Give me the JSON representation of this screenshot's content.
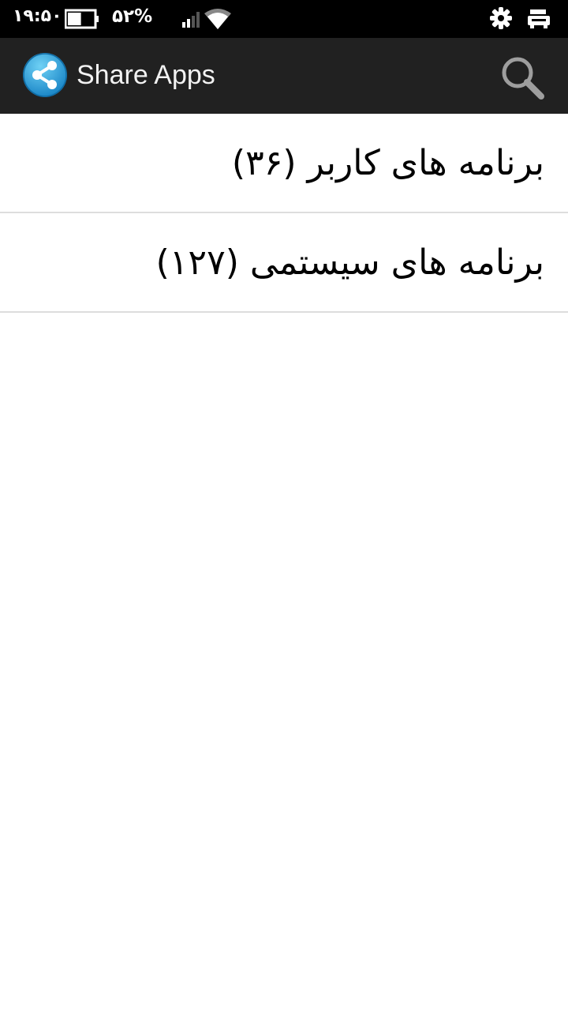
{
  "status_bar": {
    "time": "۱۹:۵۰",
    "battery_percent": "۵۲%",
    "battery_level": 0.52,
    "icons": [
      "battery-icon",
      "signal-icon",
      "wifi-icon",
      "gear-icon",
      "notification-icon"
    ]
  },
  "action_bar": {
    "app_icon": "share-icon",
    "title": "Share Apps",
    "search_icon": "search-icon",
    "background_color": "#212121",
    "accent_color": "#33aadd"
  },
  "list": {
    "items": [
      {
        "label": "برنامه های کاربر (۳۶)"
      },
      {
        "label": "برنامه های سیستمی (۱۲۷)"
      }
    ]
  }
}
